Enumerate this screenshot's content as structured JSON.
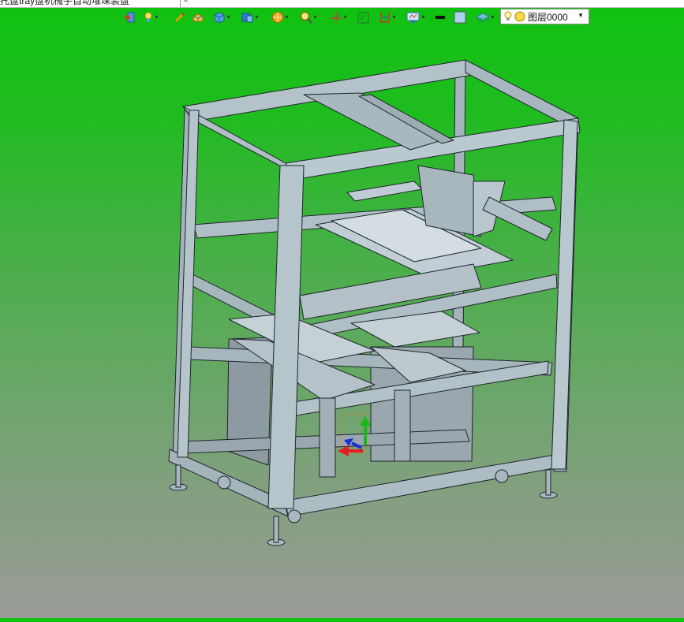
{
  "tab": {
    "title": "托盘tray盘机械手自动堆垛装盘"
  },
  "toolbar": {
    "buttons": [
      {
        "name": "import-icon"
      },
      {
        "name": "light-icon"
      },
      {
        "name": "sketch-icon"
      },
      {
        "name": "box-solid-icon"
      },
      {
        "name": "cube-view-icon"
      },
      {
        "name": "section-view-icon"
      },
      {
        "name": "render-sphere-icon"
      },
      {
        "name": "zoom-icon"
      },
      {
        "name": "triad-icon"
      },
      {
        "name": "fit-view-icon"
      },
      {
        "name": "constraint-icon"
      },
      {
        "name": "display-settings-icon"
      },
      {
        "name": "line-color-icon"
      },
      {
        "name": "fill-color-icon"
      },
      {
        "name": "layer-manager-icon"
      }
    ],
    "layer": {
      "label": "图层0000"
    }
  },
  "colors": {
    "background_top": "#0fc20f",
    "background_bottom": "#999c96",
    "frame": "#aab9c2",
    "frame_edge": "#1d262b"
  }
}
